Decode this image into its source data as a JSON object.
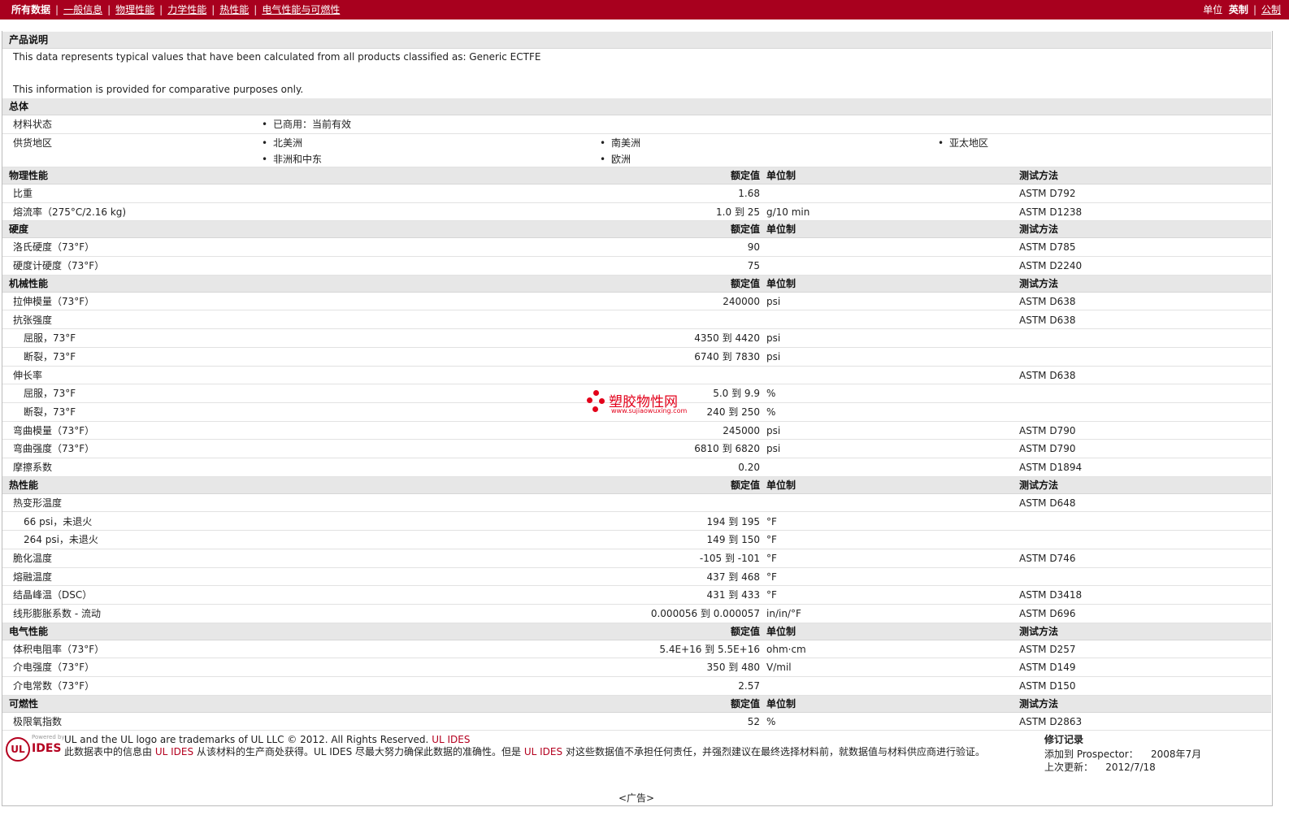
{
  "nav": {
    "current": "所有数据",
    "links": [
      "一般信息",
      "物理性能",
      "力学性能",
      "热性能",
      "电气性能与可燃性"
    ]
  },
  "units": {
    "label": "单位",
    "current": "英制",
    "other": "公制"
  },
  "description": {
    "title": "产品说明",
    "line1": "This data represents typical values that have been calculated from all products classified as: Generic ECTFE",
    "line2": "This information is provided for comparative purposes only."
  },
  "general": {
    "title": "总体",
    "status_label": "材料状态",
    "status_value": "已商用：当前有效",
    "supply_label": "供货地区",
    "regions": [
      "北美洲",
      "南美洲",
      "亚太地区",
      "非洲和中东",
      "欧洲"
    ]
  },
  "headers": {
    "value": "额定值",
    "unit": "单位制",
    "method": "测试方法"
  },
  "sections": [
    {
      "title": "物理性能",
      "rows": [
        {
          "label": "比重",
          "value": "1.68",
          "unit": "",
          "method": "ASTM D792"
        },
        {
          "label": "熔流率（275°C/2.16 kg)",
          "value": "1.0 到  25",
          "unit": "g/10 min",
          "method": "ASTM D1238"
        }
      ]
    },
    {
      "title": "硬度",
      "rows": [
        {
          "label": "洛氏硬度（73°F）",
          "value": "90",
          "unit": "",
          "method": "ASTM D785"
        },
        {
          "label": "硬度计硬度（73°F）",
          "value": "75",
          "unit": "",
          "method": "ASTM D2240"
        }
      ]
    },
    {
      "title": "机械性能",
      "rows": [
        {
          "label": "拉伸模量（73°F）",
          "value": "240000",
          "unit": "psi",
          "method": "ASTM D638"
        },
        {
          "label": "抗张强度",
          "value": "",
          "unit": "",
          "method": "ASTM D638"
        },
        {
          "label": "屈服，73°F",
          "value": "4350 到  4420",
          "unit": "psi",
          "method": "",
          "sub": true
        },
        {
          "label": "断裂，73°F",
          "value": "6740 到  7830",
          "unit": "psi",
          "method": "",
          "sub": true
        },
        {
          "label": "伸长率",
          "value": "",
          "unit": "",
          "method": "ASTM D638"
        },
        {
          "label": "屈服，73°F",
          "value": "5.0 到  9.9",
          "unit": "%",
          "method": "",
          "sub": true
        },
        {
          "label": "断裂，73°F",
          "value": "240 到  250",
          "unit": "%",
          "method": "",
          "sub": true
        },
        {
          "label": "弯曲模量（73°F）",
          "value": "245000",
          "unit": "psi",
          "method": "ASTM D790"
        },
        {
          "label": "弯曲强度（73°F）",
          "value": "6810 到  6820",
          "unit": "psi",
          "method": "ASTM D790"
        },
        {
          "label": "摩擦系数",
          "value": "0.20",
          "unit": "",
          "method": "ASTM D1894"
        }
      ]
    },
    {
      "title": "热性能",
      "rows": [
        {
          "label": "热变形温度",
          "value": "",
          "unit": "",
          "method": "ASTM D648"
        },
        {
          "label": "66 psi，未退火",
          "value": "194 到  195",
          "unit": "°F",
          "method": "",
          "sub": true
        },
        {
          "label": "264 psi，未退火",
          "value": "149 到  150",
          "unit": "°F",
          "method": "",
          "sub": true
        },
        {
          "label": "脆化温度",
          "value": "-105 到  -101",
          "unit": "°F",
          "method": "ASTM D746"
        },
        {
          "label": "熔融温度",
          "value": "437 到  468",
          "unit": "°F",
          "method": ""
        },
        {
          "label": "结晶峰温（DSC）",
          "value": "431 到  433",
          "unit": "°F",
          "method": "ASTM D3418"
        },
        {
          "label": "线形膨胀系数 - 流动",
          "value": "0.000056 到  0.000057",
          "unit": "in/in/°F",
          "method": "ASTM D696"
        }
      ]
    },
    {
      "title": "电气性能",
      "rows": [
        {
          "label": "体积电阻率（73°F）",
          "value": "5.4E+16 到  5.5E+16",
          "unit": "ohm·cm",
          "method": "ASTM D257"
        },
        {
          "label": "介电强度（73°F）",
          "value": "350 到  480",
          "unit": "V/mil",
          "method": "ASTM D149"
        },
        {
          "label": "介电常数（73°F）",
          "value": "2.57",
          "unit": "",
          "method": "ASTM D150"
        }
      ]
    },
    {
      "title": "可燃性",
      "rows": [
        {
          "label": "极限氧指数",
          "value": "52",
          "unit": "%",
          "method": "ASTM D2863"
        }
      ]
    }
  ],
  "watermark": {
    "title": "塑胶物性网",
    "url": "www.sujiaowuxing.com"
  },
  "footer": {
    "logo_powered": "Powered by",
    "logo_ul": "UL",
    "logo_ides": "IDES",
    "trademark": "UL and the UL logo are trademarks of UL LLC © 2012. All Rights Reserved.",
    "trademark_brand": "UL IDES",
    "disclaimer_1": "此数据表中的信息由",
    "disclaimer_brand1": "UL IDES",
    "disclaimer_2": "从该材料的生产商处获得。UL IDES 尽最大努力确保此数据的准确性。但是",
    "disclaimer_brand2": "UL IDES",
    "disclaimer_3": "对这些数据值不承担任何责任，并强烈建议在最终选择材料前，就数据值与材料供应商进行验证。",
    "revision_title": "修订记录",
    "added_label": "添加到 Prospector：",
    "added_value": "2008年7月",
    "updated_label": "上次更新：",
    "updated_value": "2012/7/18",
    "ad": "<广告>"
  }
}
